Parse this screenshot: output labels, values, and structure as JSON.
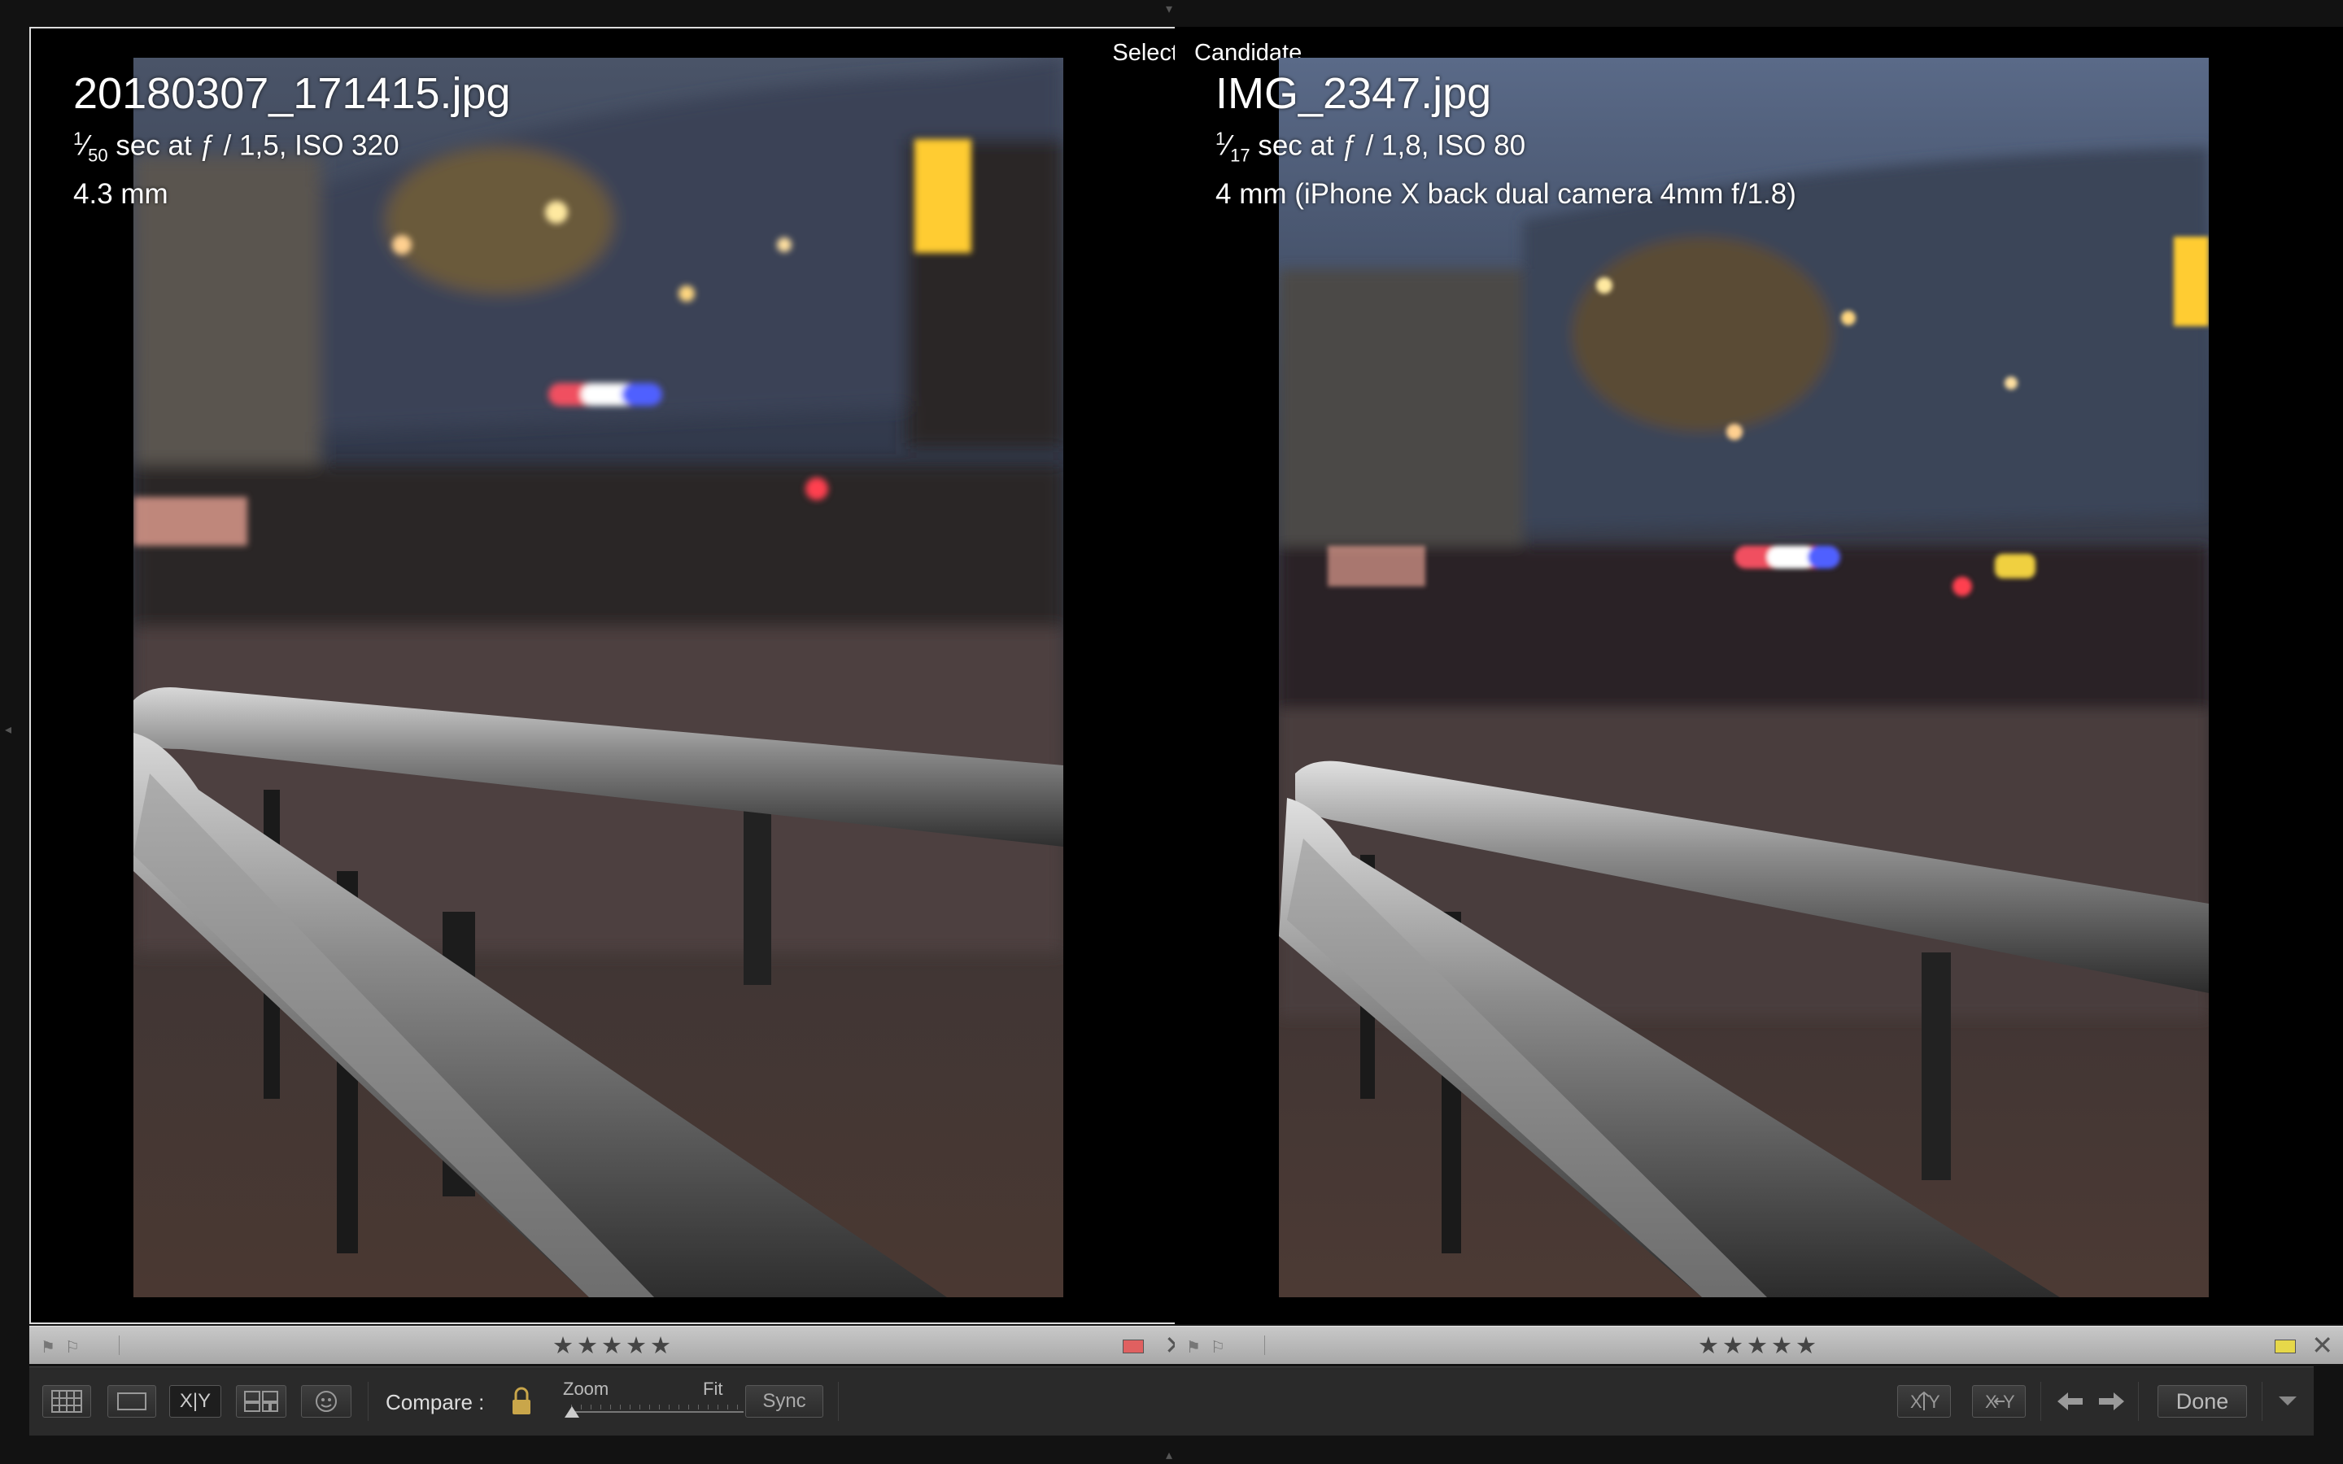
{
  "left_pane": {
    "tag": "Select",
    "filename": "20180307_171415.jpg",
    "shutter_num": "1",
    "shutter_den": "50",
    "exposure_rest": " sec at ƒ / 1,5, ISO 320",
    "focal": "4.3 mm",
    "stars": "★★★★★",
    "label_color": "#e06060"
  },
  "right_pane": {
    "tag": "Candidate",
    "filename": "IMG_2347.jpg",
    "shutter_num": "1",
    "shutter_den": "17",
    "exposure_rest": " sec at ƒ / 1,8, ISO 80",
    "focal": "4 mm (iPhone X back dual camera 4mm f/1.8)",
    "stars": "★★★★★",
    "label_color": "#e6d84a"
  },
  "toolbar": {
    "compare_label": "Compare :",
    "zoom_label": "Zoom",
    "fit_label": "Fit",
    "sync_label": "Sync",
    "done_label": "Done",
    "xy_label": "X|Y"
  },
  "icons": {
    "grid": "grid-view-icon",
    "loupe": "loupe-view-icon",
    "compare": "compare-view-icon",
    "survey": "survey-view-icon",
    "people": "people-view-icon",
    "lock": "lock-icon",
    "swap": "swap-icon",
    "make_select": "make-select-icon",
    "prev": "arrow-left-icon",
    "next": "arrow-right-icon",
    "toolbar_menu": "chevron-down-icon"
  }
}
